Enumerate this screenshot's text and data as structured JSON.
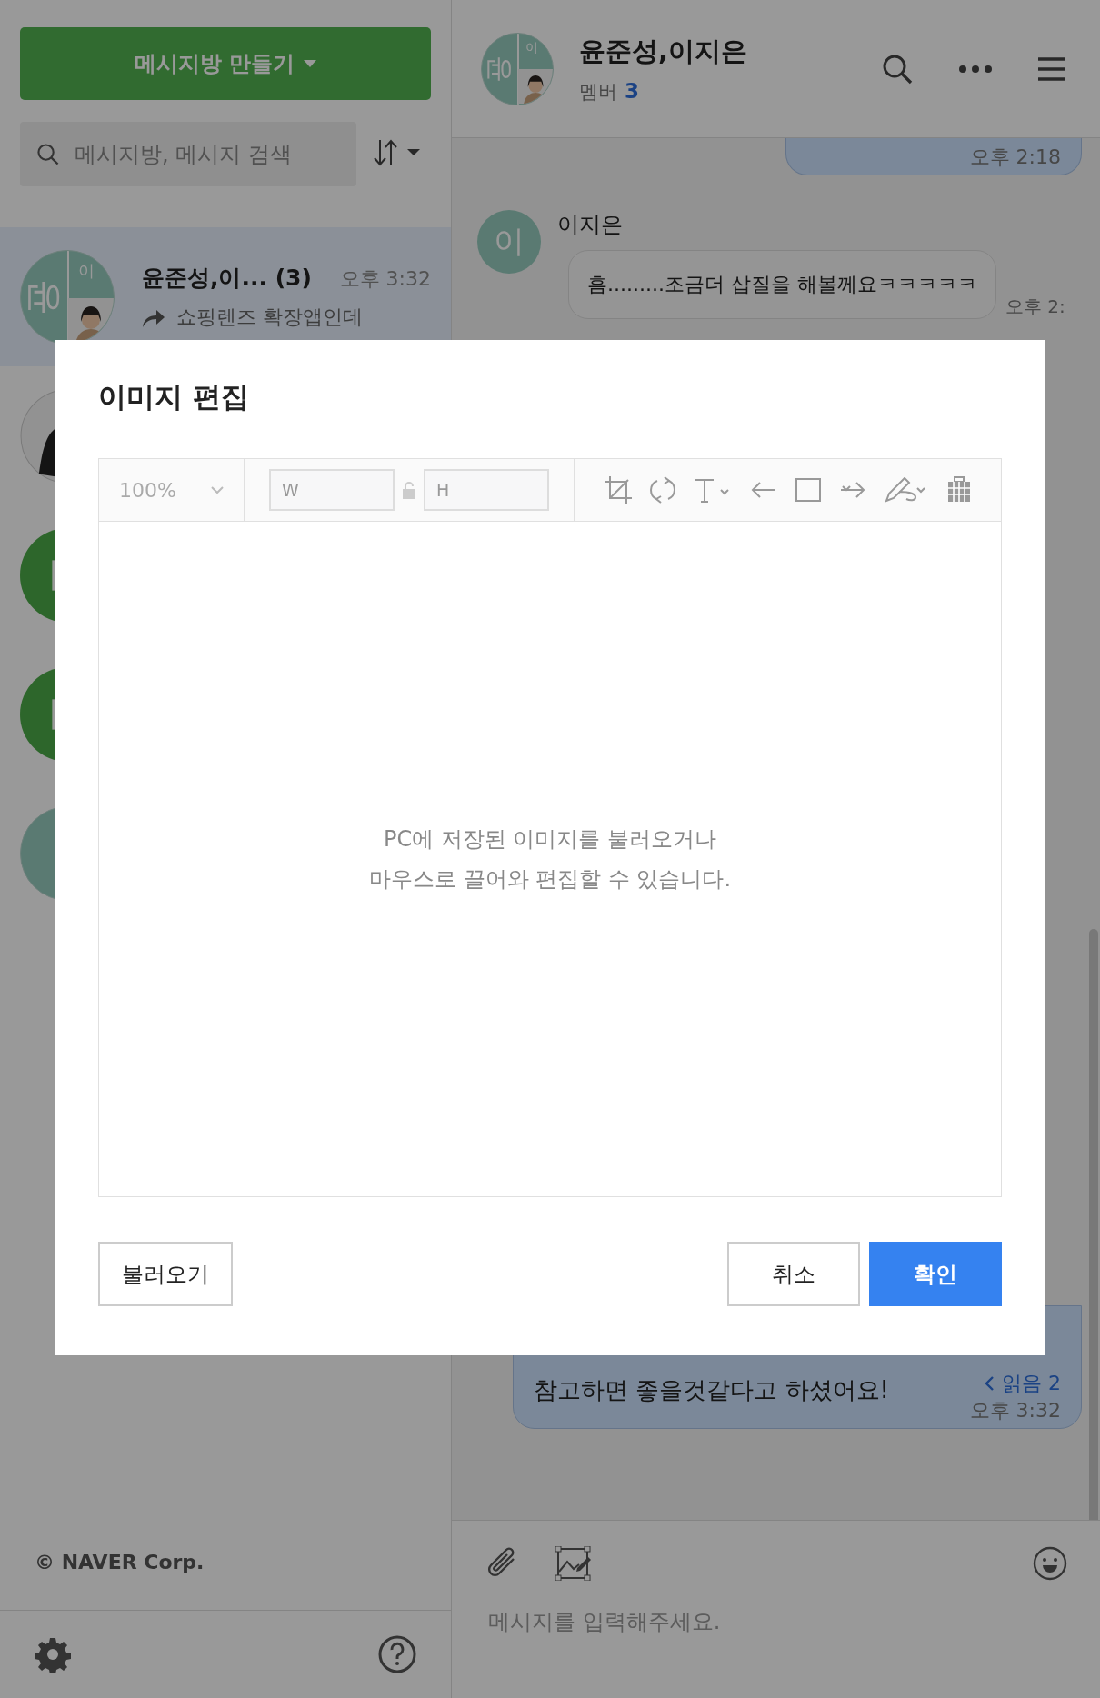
{
  "sidebar": {
    "new_room_button": "메시지방 만들기",
    "search": {
      "placeholder": "메시지방, 메시지 검색"
    },
    "rooms": [
      {
        "kind": "group",
        "letters": [
          "윤",
          "이"
        ],
        "name": "윤준성,이... (3)",
        "time": "오후 3:32",
        "preview": "쇼핑렌즈 확장앱인데",
        "selected": true
      },
      {
        "kind": "photo",
        "selected": false
      },
      {
        "kind": "green",
        "selected": false
      },
      {
        "kind": "green",
        "selected": false
      },
      {
        "kind": "group",
        "selected": false
      }
    ],
    "footer": "© NAVER Corp."
  },
  "chat": {
    "avatar_letters": [
      "윤",
      "이"
    ],
    "title": "윤준성,이지은",
    "member_label": "멤버",
    "member_count": "3",
    "messages": [
      {
        "kind": "own",
        "time": "오후 2:18"
      },
      {
        "kind": "other",
        "sender": "이지은",
        "avatar": "이",
        "text": "흠.........조금더 삽질을 해볼께요ㅋㅋㅋㅋㅋ",
        "time": "오후 2:"
      },
      {
        "kind": "own",
        "text": "참고하면 좋을것같다고 하셨어요!",
        "read": "읽음 2",
        "time": "오후 3:32"
      }
    ],
    "composer": {
      "placeholder": "메시지를 입력해주세요."
    }
  },
  "dialog": {
    "title": "이미지 편집",
    "zoom": "100%",
    "width": {
      "placeholder": "W"
    },
    "height": {
      "placeholder": "H"
    },
    "hint": [
      "PC에 저장된 이미지를 불러오거나",
      "마우스로 끌어와 편집할 수 있습니다."
    ],
    "buttons": [
      {
        "label": "불러오기",
        "kind": "secondary"
      },
      {
        "label": "취소",
        "kind": "secondary"
      },
      {
        "label": "확인",
        "kind": "primary"
      }
    ]
  }
}
